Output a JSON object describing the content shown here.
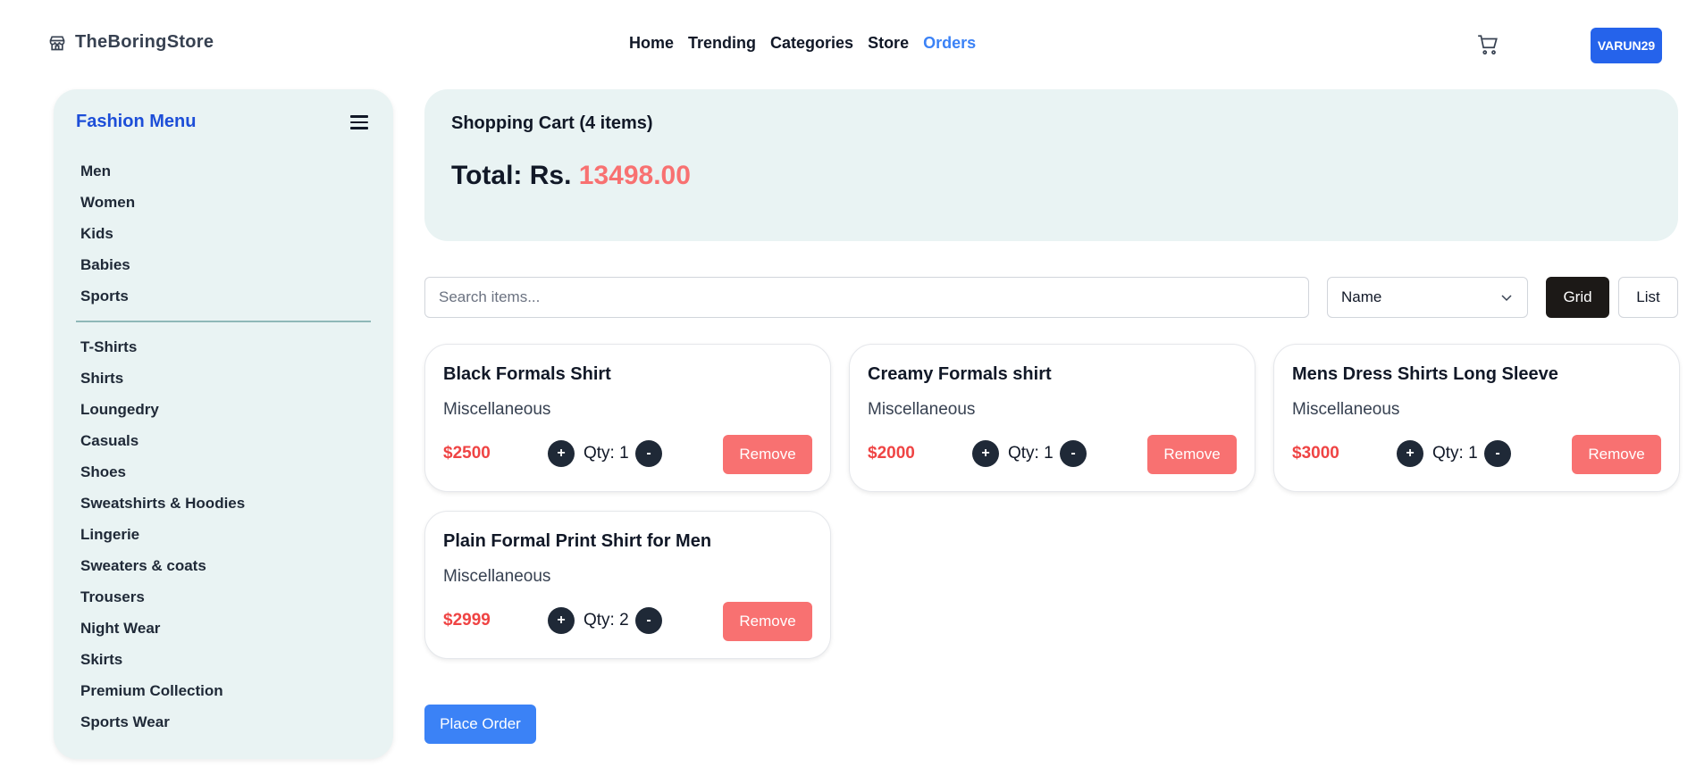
{
  "header": {
    "brand": "TheBoringStore",
    "brand_icon": "store-icon",
    "nav": [
      "Home",
      "Trending",
      "Categories",
      "Store",
      "Orders"
    ],
    "nav_active": "Orders",
    "cart_icon": "cart-icon",
    "user_label": "VARUN29"
  },
  "sidebar": {
    "title": "Fashion Menu",
    "menu_icon": "hamburger-icon",
    "group1": [
      "Men",
      "Women",
      "Kids",
      "Babies",
      "Sports"
    ],
    "group2": [
      "T-Shirts",
      "Shirts",
      "Loungedry",
      "Casuals",
      "Shoes",
      "Sweatshirts & Hoodies",
      "Lingerie",
      "Sweaters & coats",
      "Trousers",
      "Night Wear",
      "Skirts",
      "Premium Collection",
      "Sports Wear"
    ]
  },
  "summary": {
    "heading": "Shopping Cart (4 items)",
    "total_label": "Total: Rs. ",
    "total_value": "13498.00"
  },
  "toolbar": {
    "search_placeholder": "Search items...",
    "sort_value": "Name",
    "grid_label": "Grid",
    "list_label": "List"
  },
  "items": [
    {
      "title": "Black Formals Shirt",
      "category": "Miscellaneous",
      "price": "$2500",
      "qty": "Qty: 1"
    },
    {
      "title": "Creamy Formals shirt",
      "category": "Miscellaneous",
      "price": "$2000",
      "qty": "Qty: 1"
    },
    {
      "title": "Mens Dress Shirts Long Sleeve",
      "category": "Miscellaneous",
      "price": "$3000",
      "qty": "Qty: 1"
    },
    {
      "title": "Plain Formal Print Shirt for Men",
      "category": "Miscellaneous",
      "price": "$2999",
      "qty": "Qty: 2"
    }
  ],
  "item_actions": {
    "plus": "+",
    "minus": "-",
    "remove": "Remove"
  },
  "place_order_label": "Place Order",
  "colors": {
    "accent": "#3b82f6",
    "panel": "#e9f3f3",
    "remove": "#f87171",
    "price": "#ef4444"
  }
}
